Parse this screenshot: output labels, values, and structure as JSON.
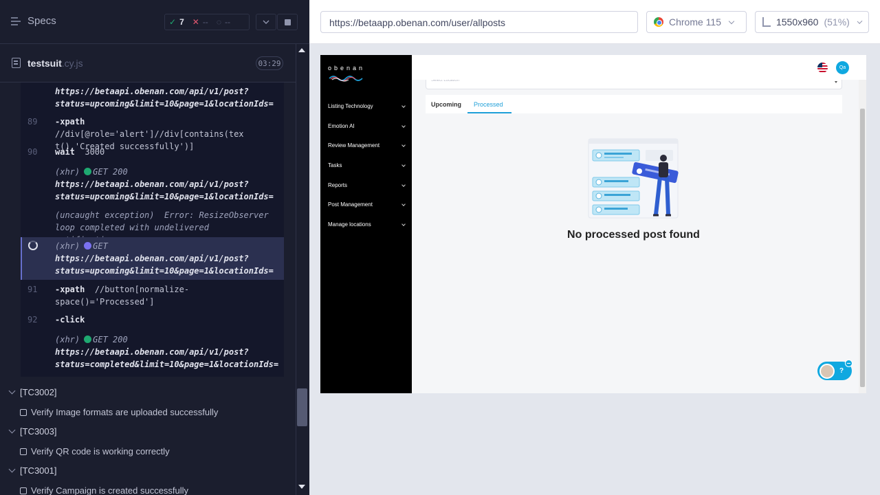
{
  "runner": {
    "specs_label": "Specs",
    "stats": {
      "passed": "7",
      "failed": "--",
      "pending": "--"
    },
    "file": {
      "name": "testsuit",
      "ext": ".cy.js",
      "duration": "03:29"
    },
    "log": [
      {
        "url1": "https://betaapi.obenan.com/api/v1/post?",
        "url2": "status=upcoming&limit=10&page=1&locationIds="
      },
      {
        "num": "89",
        "cmd": "-xpath",
        "arg1": "//div[@role='alert']//div[contains(tex",
        "arg2": "t(),'Created successfully')]"
      },
      {
        "num": "90",
        "cmd": "wait",
        "arg": "3000"
      },
      {
        "type": "(xhr)",
        "method": "GET 200",
        "url1": "https://betaapi.obenan.com/api/v1/post?",
        "url2": "status=upcoming&limit=10&page=1&locationIds="
      },
      {
        "type": "(uncaught exception)",
        "msg1": "Error: ResizeObserver",
        "msg2": "loop completed with undelivered notifications."
      },
      {
        "type": "(xhr)",
        "method": "GET",
        "url1": "https://betaapi.obenan.com/api/v1/post?",
        "url2": "status=upcoming&limit=10&page=1&locationIds="
      },
      {
        "num": "91",
        "cmd": "-xpath",
        "arg1": "//button[normalize-",
        "arg2": "space()='Processed']"
      },
      {
        "num": "92",
        "cmd": "-click"
      },
      {
        "type": "(xhr)",
        "method": "GET 200",
        "url1": "https://betaapi.obenan.com/api/v1/post?",
        "url2": "status=completed&limit=10&page=1&locationIds="
      }
    ],
    "suites": [
      {
        "label": "[TC3002]",
        "test": "Verify Image formats are uploaded successfully"
      },
      {
        "label": "[TC3003]",
        "test": "Verify QR code is working correctly"
      },
      {
        "label": "[TC3001]",
        "test": "Verify Campaign is created successfully"
      }
    ]
  },
  "aut_header": {
    "url": "https://betaapp.obenan.com/user/allposts",
    "browser": "Chrome 115",
    "viewport": "1550x960",
    "scale": "(51%)"
  },
  "app": {
    "logo": "obenan",
    "nav": [
      "Listing Technology",
      "Emotion AI",
      "Review Management",
      "Tasks",
      "Reports",
      "Post Management",
      "Manage locations"
    ],
    "avatar_initials": "Qa",
    "location_placeholder": "Select Location",
    "tabs": {
      "upcoming": "Upcoming",
      "processed": "Processed"
    },
    "empty_message": "No processed post found",
    "help_label": "?"
  },
  "colors": {
    "runner_bg": "#1b1e2e",
    "pass": "#1fa971",
    "fail": "#e45770",
    "accent": "#1e9fd8"
  }
}
